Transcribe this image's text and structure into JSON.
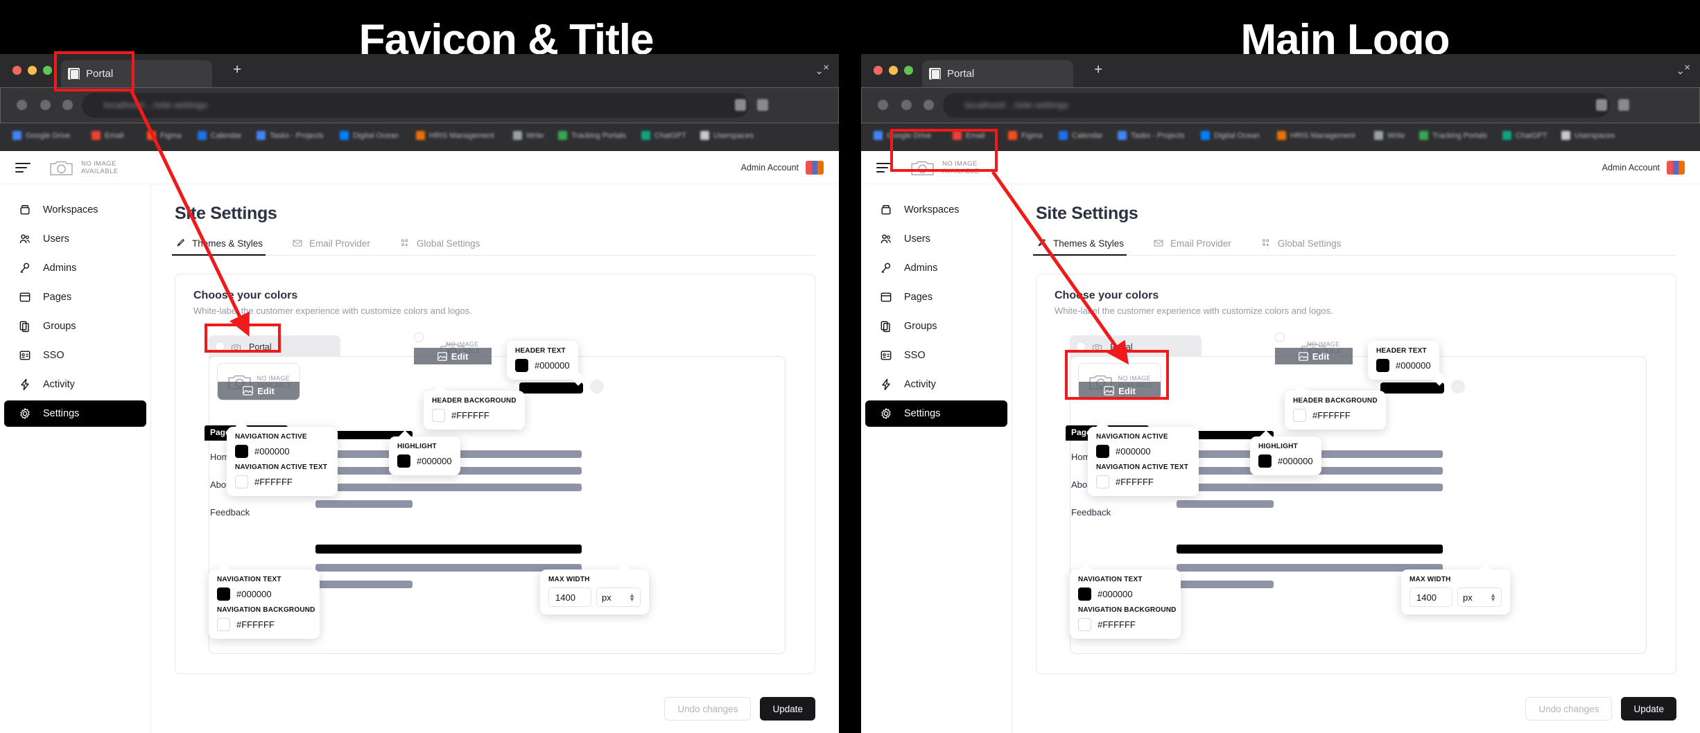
{
  "annotations": {
    "favicon_banner": "Favicon & Title",
    "logo_banner": "Main Logo"
  },
  "browser": {
    "tab_title": "Portal",
    "tab_close_glyph": "×",
    "new_tab_glyph": "+",
    "tab_list_chevron": "⌄",
    "address_text": "localhost/.../site-settings",
    "bookmarks": [
      "Google Drive",
      "Email",
      "Figma",
      "Calendar",
      "Tasks - Projects",
      "Digital Ocean",
      "HRIS Management",
      "Write",
      "Tracking Portals",
      "ChatGPT",
      "Userspaces"
    ]
  },
  "app": {
    "logo_placeholder_line1": "NO IMAGE",
    "logo_placeholder_line2": "AVAILABLE",
    "account_name": "Admin Account"
  },
  "sidebar": {
    "items": [
      {
        "label": "Workspaces",
        "icon": "workspace-icon",
        "active": false
      },
      {
        "label": "Users",
        "icon": "users-icon",
        "active": false
      },
      {
        "label": "Admins",
        "icon": "key-icon",
        "active": false
      },
      {
        "label": "Pages",
        "icon": "pages-icon",
        "active": false
      },
      {
        "label": "Groups",
        "icon": "groups-icon",
        "active": false
      },
      {
        "label": "SSO",
        "icon": "badge-icon",
        "active": false
      },
      {
        "label": "Activity",
        "icon": "bolt-icon",
        "active": false
      },
      {
        "label": "Settings",
        "icon": "gear-icon",
        "active": true
      }
    ]
  },
  "main": {
    "page_title": "Site Settings",
    "tabs": [
      {
        "label": "Themes & Styles",
        "icon": "brush-icon",
        "active": true
      },
      {
        "label": "Email Provider",
        "icon": "mail-icon",
        "active": false
      },
      {
        "label": "Global Settings",
        "icon": "global-icon",
        "active": false
      }
    ],
    "panel": {
      "heading": "Choose your colors",
      "subheading": "White-label the customer experience with customize colors and logos."
    },
    "preview": {
      "browser_tab_title": "Portal",
      "logo_placeholder_line1": "NO IMAGE",
      "logo_placeholder_line2": "AVAILABLE",
      "edit_label": "Edit",
      "nav_title": "Pages",
      "nav_links": [
        "Home",
        "About",
        "Feedback"
      ]
    },
    "swatches": [
      {
        "id": "header-text",
        "label": "HEADER TEXT",
        "value": "#000000",
        "kind": "black"
      },
      {
        "id": "header-background",
        "label": "HEADER BACKGROUND",
        "value": "#FFFFFF",
        "kind": "white"
      },
      {
        "id": "navigation-active",
        "label": "NAVIGATION ACTIVE",
        "value": "#000000",
        "kind": "black"
      },
      {
        "id": "navigation-active-text",
        "label": "NAVIGATION ACTIVE TEXT",
        "value": "#FFFFFF",
        "kind": "white"
      },
      {
        "id": "highlight",
        "label": "HIGHLIGHT",
        "value": "#000000",
        "kind": "black"
      },
      {
        "id": "navigation-text",
        "label": "NAVIGATION TEXT",
        "value": "#000000",
        "kind": "black"
      },
      {
        "id": "navigation-background",
        "label": "NAVIGATION BACKGROUND",
        "value": "#FFFFFF",
        "kind": "white"
      }
    ],
    "max_width": {
      "label": "MAX WIDTH",
      "value": "1400",
      "unit": "px"
    },
    "footer": {
      "undo_label": "Undo changes",
      "update_label": "Update"
    }
  },
  "colors": {
    "accent_dark": "#000000",
    "callout_red": "#F01A1A",
    "title_navy": "#2D3142",
    "muted": "#9699A8"
  }
}
